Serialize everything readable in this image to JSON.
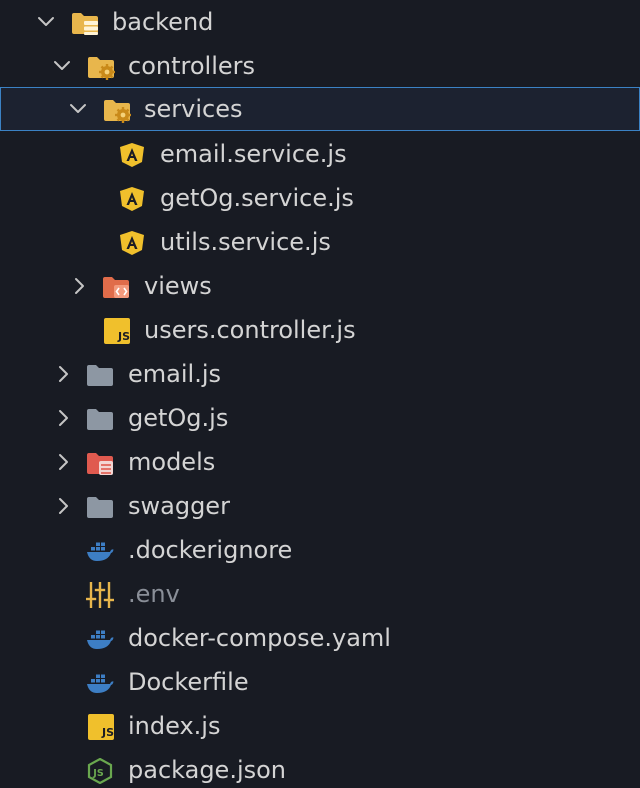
{
  "colors": {
    "background": "#181b23",
    "selection_border": "#3b82c4",
    "text": "#d4d4d4",
    "dim_text": "#8a8f98",
    "folder_yellow": "#e8b64c",
    "angular_yellow": "#f0c02c",
    "views_red": "#e06c4a",
    "models_red": "#e05a4f",
    "plain_folder": "#8d97a3",
    "docker_blue": "#3d7ec4",
    "js_yellow": "#f0c02c",
    "node_green": "#6aa84f"
  },
  "tree": {
    "backend": {
      "label": "backend",
      "icon": "folder-server-icon"
    },
    "controllers": {
      "label": "controllers",
      "icon": "folder-gear-icon"
    },
    "services": {
      "label": "services",
      "icon": "folder-gear-icon"
    },
    "email_service": {
      "label": "email.service.js",
      "icon": "angular-icon"
    },
    "getog_service": {
      "label": "getOg.service.js",
      "icon": "angular-icon"
    },
    "utils_service": {
      "label": "utils.service.js",
      "icon": "angular-icon"
    },
    "views": {
      "label": "views",
      "icon": "folder-views-icon"
    },
    "users_controller": {
      "label": "users.controller.js",
      "icon": "js-file-icon"
    },
    "email_js": {
      "label": "email.js",
      "icon": "folder-icon"
    },
    "getog_js": {
      "label": "getOg.js",
      "icon": "folder-icon"
    },
    "models": {
      "label": "models",
      "icon": "folder-database-icon"
    },
    "swagger": {
      "label": "swagger",
      "icon": "folder-icon"
    },
    "dockerignore": {
      "label": ".dockerignore",
      "icon": "docker-icon"
    },
    "env": {
      "label": ".env",
      "icon": "tune-icon"
    },
    "docker_compose": {
      "label": "docker-compose.yaml",
      "icon": "docker-icon"
    },
    "dockerfile": {
      "label": "Dockerfile",
      "icon": "docker-icon"
    },
    "index_js": {
      "label": "index.js",
      "icon": "js-file-icon"
    },
    "package_json": {
      "label": "package.json",
      "icon": "nodejs-icon"
    }
  }
}
